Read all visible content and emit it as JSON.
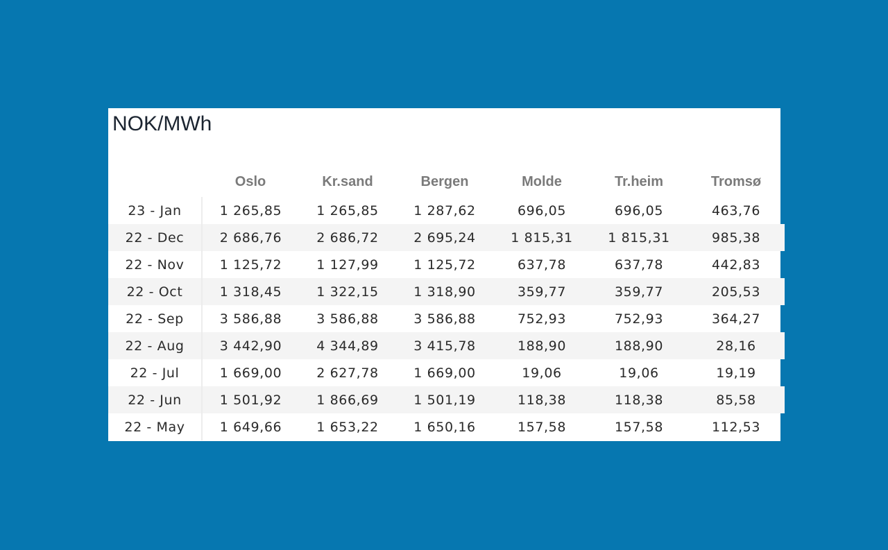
{
  "title": "NOK/MWh",
  "colors": {
    "background": "#0677b0",
    "card": "#ffffff",
    "header_text": "#7a7a7a",
    "stripe": "#f4f4f4"
  },
  "chart_data": {
    "type": "table",
    "title": "NOK/MWh",
    "columns": [
      "",
      "Oslo",
      "Kr.sand",
      "Bergen",
      "Molde",
      "Tr.heim",
      "Tromsø"
    ],
    "rows": [
      [
        "23 - Jan",
        "1 265,85",
        "1 265,85",
        "1 287,62",
        "696,05",
        "696,05",
        "463,76"
      ],
      [
        "22 - Dec",
        "2 686,76",
        "2 686,72",
        "2 695,24",
        "1 815,31",
        "1 815,31",
        "985,38"
      ],
      [
        "22 - Nov",
        "1 125,72",
        "1 127,99",
        "1 125,72",
        "637,78",
        "637,78",
        "442,83"
      ],
      [
        "22 - Oct",
        "1 318,45",
        "1 322,15",
        "1 318,90",
        "359,77",
        "359,77",
        "205,53"
      ],
      [
        "22 - Sep",
        "3 586,88",
        "3 586,88",
        "3 586,88",
        "752,93",
        "752,93",
        "364,27"
      ],
      [
        "22 - Aug",
        "3 442,90",
        "4 344,89",
        "3 415,78",
        "188,90",
        "188,90",
        "28,16"
      ],
      [
        "22 - Jul",
        "1 669,00",
        "2 627,78",
        "1 669,00",
        "19,06",
        "19,06",
        "19,19"
      ],
      [
        "22 - Jun",
        "1 501,92",
        "1 866,69",
        "1 501,19",
        "118,38",
        "118,38",
        "85,58"
      ],
      [
        "22 - May",
        "1 649,66",
        "1 653,22",
        "1 650,16",
        "157,58",
        "157,58",
        "112,53"
      ]
    ]
  }
}
